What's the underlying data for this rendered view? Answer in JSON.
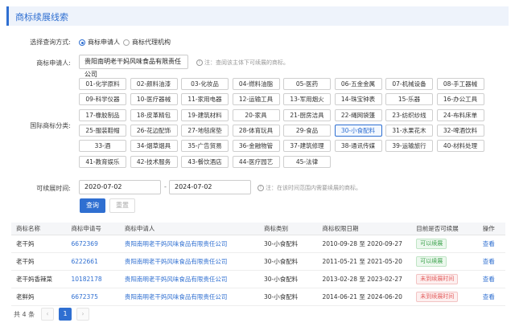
{
  "header": {
    "title": "商标续展线索"
  },
  "query_mode": {
    "label": "选择查询方式:",
    "options": [
      {
        "label": "商标申请人",
        "selected": true
      },
      {
        "label": "商标代理机构",
        "selected": false
      }
    ]
  },
  "applicant": {
    "label": "商标申请人:",
    "value": "贵阳南明老干妈风味食品有限责任公司",
    "hint": "注：查阅该主体下可续展的商标。"
  },
  "classes": {
    "label": "国际商标分类:",
    "items": [
      "01-化学原料",
      "02-颜料油漆",
      "03-化妆品",
      "04-燃料油脂",
      "05-医药",
      "06-五金金属",
      "07-机械设备",
      "08-手工器械",
      "09-科学仪器",
      "10-医疗器械",
      "11-家用电器",
      "12-运输工具",
      "13-军用烟火",
      "14-珠宝钟表",
      "15-乐器",
      "16-办公工具",
      "17-橡胶制品",
      "18-皮革精包",
      "19-建筑材料",
      "20-家具",
      "21-厨房洁具",
      "22-绳网袋篷",
      "23-纺织纱线",
      "24-布料床单",
      "25-服装鞋帽",
      "26-花边配饰",
      "27-地毯席垫",
      "28-体育玩具",
      "29-食品",
      "30-小食配料",
      "31-水果花木",
      "32-啤酒饮料",
      "33-酒",
      "34-烟草烟具",
      "35-广告贸易",
      "36-金融物管",
      "37-建筑修理",
      "38-通讯传媒",
      "39-运输旅行",
      "40-材料处理",
      "41-教育娱乐",
      "42-技术服务",
      "43-餐饮酒店",
      "44-医疗园艺",
      "45-法律"
    ],
    "selected": "30-小食配料"
  },
  "renew_time": {
    "label": "可续展时间:",
    "start": "2020-07-02",
    "end": "2024-07-02",
    "separator": "-",
    "hint": "注：在该时间范围内需要续展的商标。"
  },
  "actions": {
    "search": "查询",
    "reset": "重置"
  },
  "table": {
    "headers": [
      "商标名称",
      "商标申请号",
      "商标申请人",
      "商标类别",
      "商标权限日期",
      "目前是否可续展",
      "操作"
    ],
    "rows": [
      {
        "name": "老干妈",
        "reg_no": "6672369",
        "applicant": "贵阳南明老干妈风味食品有限责任公司",
        "category": "30-小食配料",
        "period": "2010-09-28 至 2020-09-27",
        "status": "可以续展",
        "status_type": "ok",
        "action": "查看"
      },
      {
        "name": "老干妈",
        "reg_no": "6222661",
        "applicant": "贵阳南明老干妈风味食品有限责任公司",
        "category": "30-小食配料",
        "period": "2011-05-21 至 2021-05-20",
        "status": "可以续展",
        "status_type": "ok",
        "action": "查看"
      },
      {
        "name": "老干妈香辣菜",
        "reg_no": "10182178",
        "applicant": "贵阳南明老干妈风味食品有限责任公司",
        "category": "30-小食配料",
        "period": "2013-02-28 至 2023-02-27",
        "status": "未到续展时间",
        "status_type": "no",
        "action": "查看"
      },
      {
        "name": "老鲜妈",
        "reg_no": "6672375",
        "applicant": "贵阳南明老干妈风味食品有限责任公司",
        "category": "30-小食配料",
        "period": "2014-06-21 至 2024-06-20",
        "status": "未到续展时间",
        "status_type": "no",
        "action": "查看"
      }
    ]
  },
  "pagination": {
    "total": "共 4 条",
    "current": "1",
    "prev": "‹",
    "next": "›"
  },
  "colors": {
    "accent": "#2f6fd1",
    "ok": "#3aa14b",
    "warn": "#e35b5b"
  }
}
